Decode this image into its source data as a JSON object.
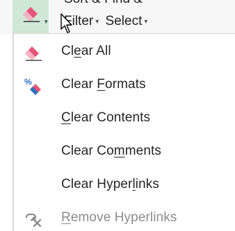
{
  "ribbon": {
    "top_text": "Sort & Find &",
    "filter_label": "Filter",
    "select_label": "Select",
    "caret": "▾"
  },
  "menu": {
    "items": [
      {
        "pre": "Cl",
        "key": "e",
        "post": "ar All",
        "icon": "eraser-icon",
        "disabled": false
      },
      {
        "pre": "Clear ",
        "key": "F",
        "post": "ormats",
        "icon": "clear-formats-icon",
        "disabled": false
      },
      {
        "pre": "",
        "key": "C",
        "post": "lear Contents",
        "icon": "",
        "disabled": false
      },
      {
        "pre": "Clear Co",
        "key": "m",
        "post": "ments",
        "icon": "",
        "disabled": false
      },
      {
        "pre": "Clear Hyper",
        "key": "l",
        "post": "inks",
        "icon": "",
        "disabled": false
      },
      {
        "pre": "",
        "key": "R",
        "post": "emove Hyperlinks",
        "icon": "remove-hyperlink-icon",
        "disabled": true
      }
    ]
  },
  "colors": {
    "eraser_pink": "#e8557a",
    "eraser_white": "#ffffff",
    "highlight_green": "#cfe8d6",
    "formats_blue": "#2f6fbf",
    "disabled_gray": "#8c8c8c"
  }
}
